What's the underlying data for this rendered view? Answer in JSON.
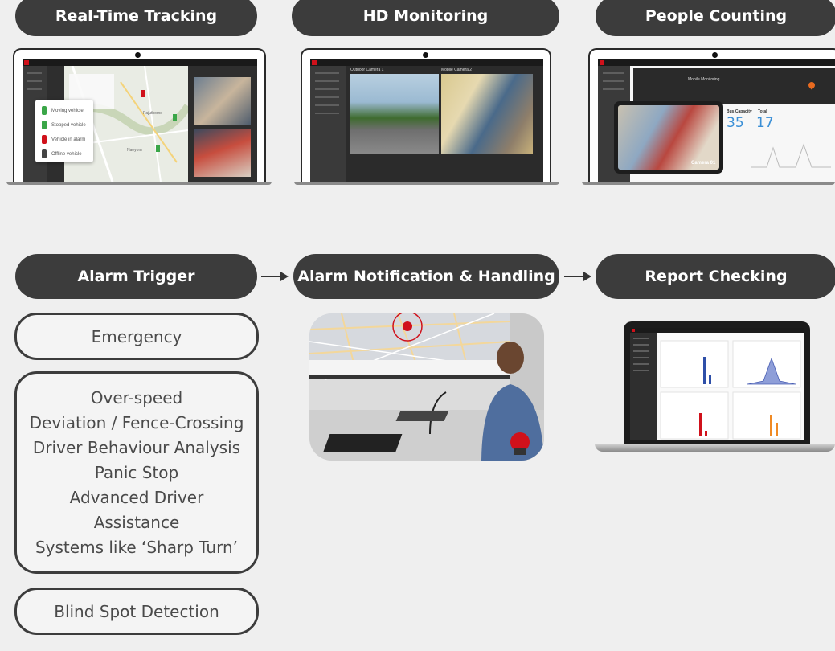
{
  "top_row": {
    "pills": [
      "Real-Time Tracking",
      "HD Monitoring",
      "People Counting"
    ]
  },
  "tracking_screen": {
    "legend": [
      "Moving vehicle",
      "Stopped vehicle",
      "Vehicle in alarm",
      "Offline vehicle"
    ],
    "legend_colors": [
      "#3aa648",
      "#3aa648",
      "#d0111b",
      "#444444"
    ],
    "map_labels": [
      "Pajuthome",
      "Naeyom"
    ]
  },
  "monitoring_screen": {
    "camera_labels": [
      "Outdoor Camera 1",
      "Mobile Camera 2"
    ]
  },
  "counting_screen": {
    "title": "Mobile Monitoring",
    "metric_labels": [
      "Bus Capacity",
      "Total"
    ],
    "metric_values": [
      "35",
      "17"
    ],
    "tablet_caption": "Camera 01"
  },
  "bottom_row": {
    "pills": [
      "Alarm Trigger",
      "Alarm Notification & Handling",
      "Report Checking"
    ],
    "triggers": {
      "emergency": "Emergency",
      "group": [
        "Over-speed",
        "Deviation / Fence-Crossing",
        "Driver Behaviour Analysis",
        "Panic Stop",
        "Advanced Driver",
        "Assistance",
        "Systems like ‘Sharp Turn’"
      ],
      "blind_spot": "Blind Spot Detection"
    }
  },
  "colors": {
    "accent_red": "#d0111b",
    "pill_dark": "#3c3c3c",
    "chart_blue": "#2e4fa8",
    "chart_orange": "#f08a24",
    "metric_blue": "#3a8fd6"
  },
  "icons": [
    "arrow-right-icon",
    "alarm-beacon-icon",
    "location-pin-icon"
  ]
}
